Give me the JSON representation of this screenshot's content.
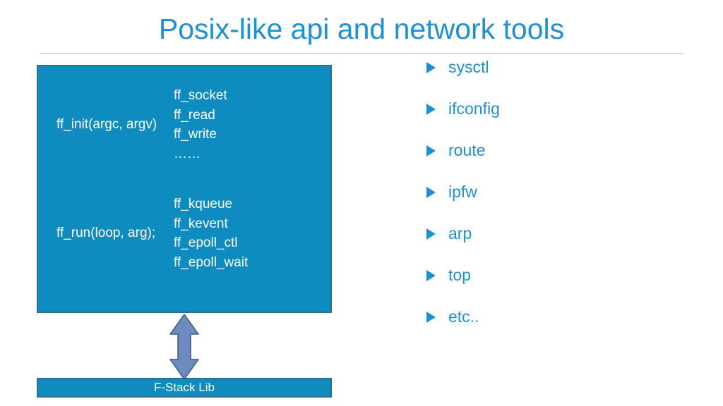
{
  "title": "Posix-like api and network tools",
  "colors": {
    "accent": "#1e90d6",
    "box_fill": "#0f8cbf",
    "box_border": "#2f6e94",
    "arrow_fill": "#6d8bbf",
    "arrow_stroke": "#3a5a8a",
    "rule": "#d9d9d9"
  },
  "api_box": {
    "row1_left": "ff_init(argc, argv)",
    "row1_right": [
      "ff_socket",
      "ff_read",
      "ff_write",
      "……"
    ],
    "row2_left": "ff_run(loop, arg);",
    "row2_right": [
      "ff_kqueue",
      "ff_kevent",
      "ff_epoll_ctl",
      "ff_epoll_wait"
    ]
  },
  "lib_box": {
    "label": "F-Stack Lib"
  },
  "tools": [
    "sysctl",
    "ifconfig",
    "route",
    "ipfw",
    "arp",
    "top",
    "etc.."
  ]
}
